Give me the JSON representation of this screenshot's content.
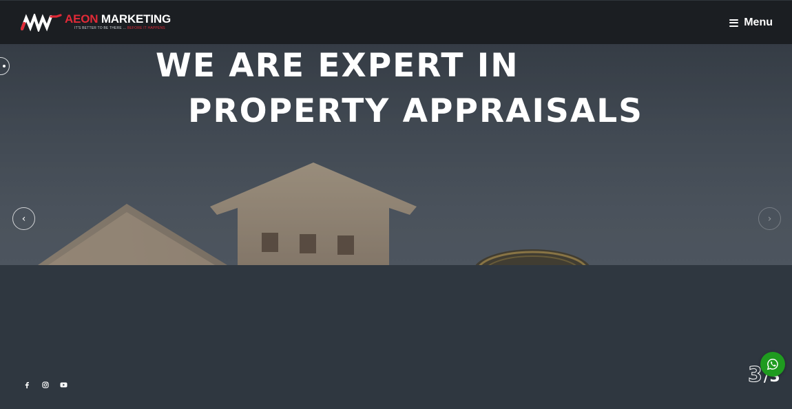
{
  "brand": {
    "name_accent": "AEON",
    "name_rest": " MARKETING",
    "tagline_start": "IT'S BETTER TO BE THERE ...",
    "tagline_end": " BEFORE IT HAPPENS",
    "accent_color": "#e22a37"
  },
  "nav": {
    "menu_label": "Menu",
    "menu_icon": "hamburger-icon"
  },
  "hero": {
    "line1": "WE ARE EXPERT IN",
    "line2": "PROPERTY APPRAISALS",
    "prev_label": "‹",
    "next_label": "›"
  },
  "slider": {
    "current": "3",
    "separator": "/",
    "total": "3"
  },
  "socials": [
    {
      "name": "facebook-icon"
    },
    {
      "name": "instagram-icon"
    },
    {
      "name": "youtube-icon"
    }
  ],
  "whatsapp": {
    "icon": "whatsapp-icon",
    "color": "#1f9b1f"
  }
}
